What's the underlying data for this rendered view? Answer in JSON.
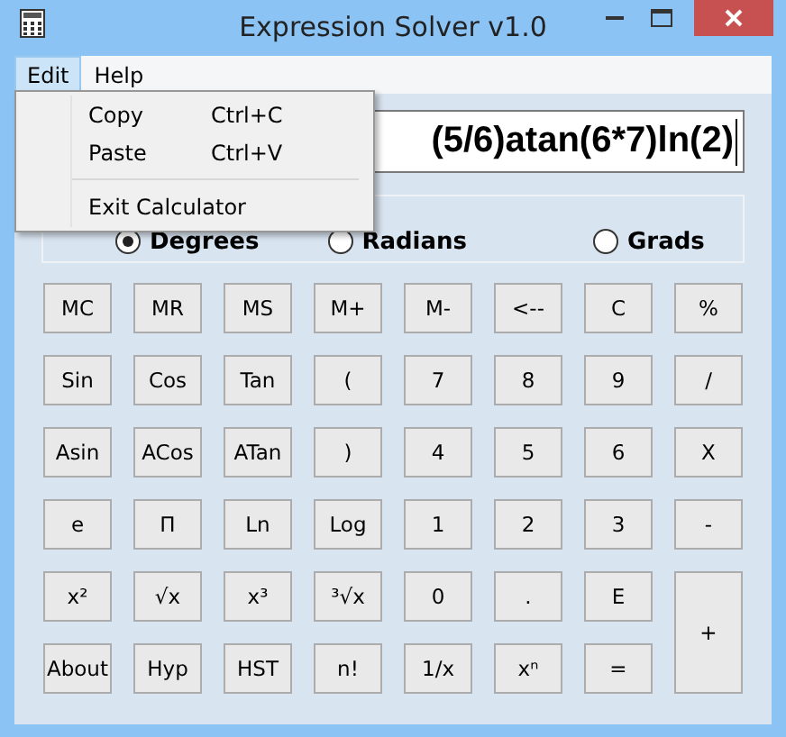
{
  "window": {
    "title": "Expression Solver v1.0"
  },
  "menu_bar": [
    {
      "label": "Edit",
      "selected": true
    },
    {
      "label": "Help",
      "selected": false
    }
  ],
  "dropdown": [
    {
      "kind": "item",
      "label": "Copy",
      "shortcut": "Ctrl+C"
    },
    {
      "kind": "item",
      "label": "Paste",
      "shortcut": "Ctrl+V"
    },
    {
      "kind": "separator"
    },
    {
      "kind": "item",
      "label": "Exit Calculator"
    }
  ],
  "expression": {
    "value": "(5/6)atan(6*7)ln(2)"
  },
  "angle_modes": [
    {
      "label": "Degrees",
      "selected": true
    },
    {
      "label": "Radians",
      "selected": false
    },
    {
      "label": "Grads",
      "selected": false
    }
  ],
  "keypad": [
    {
      "label": "MC"
    },
    {
      "label": "MR"
    },
    {
      "label": "MS"
    },
    {
      "label": "M+"
    },
    {
      "label": "M-"
    },
    {
      "label": "<--"
    },
    {
      "label": "C"
    },
    {
      "label": "%"
    },
    {
      "label": "Sin"
    },
    {
      "label": "Cos"
    },
    {
      "label": "Tan"
    },
    {
      "label": "("
    },
    {
      "label": "7"
    },
    {
      "label": "8"
    },
    {
      "label": "9"
    },
    {
      "label": "/"
    },
    {
      "label": "Asin"
    },
    {
      "label": "ACos"
    },
    {
      "label": "ATan"
    },
    {
      "label": ")"
    },
    {
      "label": "4"
    },
    {
      "label": "5"
    },
    {
      "label": "6"
    },
    {
      "label": "X"
    },
    {
      "label": "e"
    },
    {
      "label": "Π"
    },
    {
      "label": "Ln"
    },
    {
      "label": "Log"
    },
    {
      "label": "1"
    },
    {
      "label": "2"
    },
    {
      "label": "3"
    },
    {
      "label": "-"
    },
    {
      "label": "x²"
    },
    {
      "label": "√x"
    },
    {
      "label": "x³"
    },
    {
      "label": "³√x"
    },
    {
      "label": "0"
    },
    {
      "label": "."
    },
    {
      "label": "E"
    },
    {
      "label": "+",
      "kind": "tall"
    },
    {
      "label": "About"
    },
    {
      "label": "Hyp"
    },
    {
      "label": "HST"
    },
    {
      "label": "n!"
    },
    {
      "label": "1/x"
    },
    {
      "label": "xⁿ"
    },
    {
      "label": "="
    }
  ]
}
